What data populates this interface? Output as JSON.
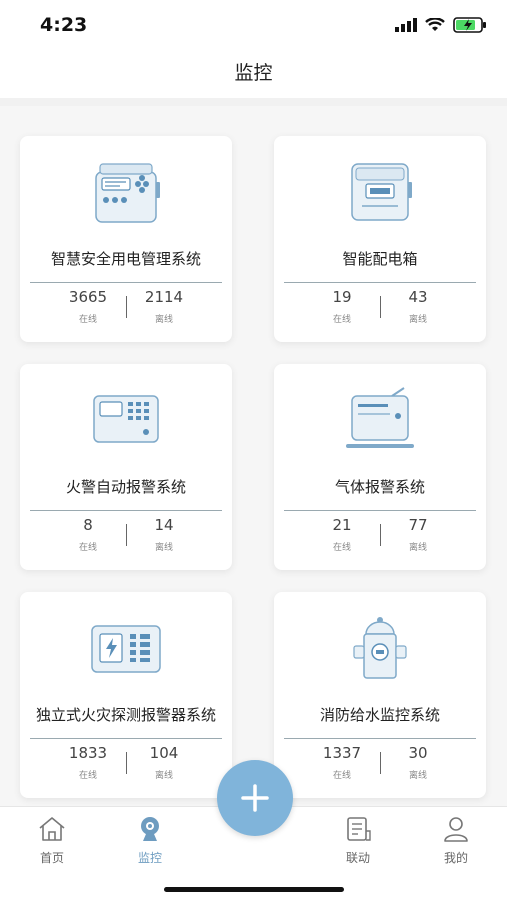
{
  "status_bar": {
    "time": "4:23"
  },
  "header": {
    "title": "监控"
  },
  "cards": [
    {
      "title": "智慧安全用电管理系统",
      "online": "3665",
      "offline": "2114",
      "online_label": "在线",
      "offline_label": "离线",
      "icon": "electric-panel-icon"
    },
    {
      "title": "智能配电箱",
      "online": "19",
      "offline": "43",
      "online_label": "在线",
      "offline_label": "离线",
      "icon": "distribution-box-icon"
    },
    {
      "title": "火警自动报警系统",
      "online": "8",
      "offline": "14",
      "online_label": "在线",
      "offline_label": "离线",
      "icon": "fire-alarm-panel-icon"
    },
    {
      "title": "气体报警系统",
      "online": "21",
      "offline": "77",
      "online_label": "在线",
      "offline_label": "离线",
      "icon": "gas-alarm-icon"
    },
    {
      "title": "独立式火灾探测报警器系统",
      "online": "1833",
      "offline": "104",
      "online_label": "在线",
      "offline_label": "离线",
      "icon": "fire-detector-icon"
    },
    {
      "title": "消防给水监控系统",
      "online": "1337",
      "offline": "30",
      "online_label": "在线",
      "offline_label": "离线",
      "icon": "hydrant-icon"
    }
  ],
  "tabs": [
    {
      "label": "首页",
      "icon": "home-icon",
      "active": false
    },
    {
      "label": "监控",
      "icon": "camera-icon",
      "active": true
    },
    {
      "label": "联动",
      "icon": "document-icon",
      "active": false
    },
    {
      "label": "我的",
      "icon": "user-icon",
      "active": false
    }
  ],
  "fab": {
    "icon": "plus-icon"
  },
  "colors": {
    "accent": "#80b4da",
    "tab_active": "#6e9cc0",
    "icon_blue": "#5a8fb8"
  }
}
